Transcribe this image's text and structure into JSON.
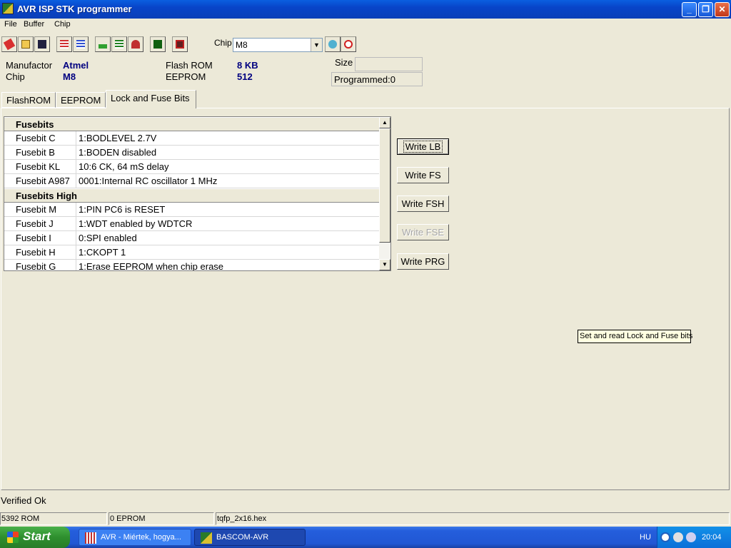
{
  "window": {
    "title": "AVR ISP STK programmer"
  },
  "menu": [
    "File",
    "Buffer",
    "Chip"
  ],
  "toolbar": {
    "chip_label": "Chip",
    "chip_value": "M8",
    "icons": [
      "eraser-icon",
      "open-folder-icon",
      "save-icon",
      "chip-read-icon",
      "chip-write-icon",
      "program-icon",
      "verify-icon",
      "erase-chip-icon",
      "blank-check-icon",
      "lock-icon",
      "refresh-icon",
      "stop-icon"
    ]
  },
  "info": {
    "manufactor_label": "Manufactor",
    "manufactor_value": "Atmel",
    "chip_label": "Chip",
    "chip_value": "M8",
    "flash_label": "Flash ROM",
    "flash_value": "8 KB",
    "eeprom_label": "EEPROM",
    "eeprom_value": "512",
    "size_label": "Size",
    "size_value": "",
    "programmed": "Programmed:0"
  },
  "tabs": [
    "FlashROM",
    "EEPROM",
    "Lock and Fuse Bits"
  ],
  "fuse_list": {
    "group1": "Fusebits",
    "rows1": [
      {
        "name": "Fusebit C",
        "value": "1:BODLEVEL 2.7V"
      },
      {
        "name": "Fusebit B",
        "value": "1:BODEN disabled"
      },
      {
        "name": "Fusebit KL",
        "value": "10:6 CK, 64 mS delay"
      },
      {
        "name": "Fusebit A987",
        "value": "0001:Internal RC oscillator 1 MHz"
      }
    ],
    "group2": "Fusebits High",
    "rows2": [
      {
        "name": "Fusebit M",
        "value": "1:PIN PC6 is RESET"
      },
      {
        "name": "Fusebit J",
        "value": "1:WDT enabled by WDTCR"
      },
      {
        "name": "Fusebit I",
        "value": "0:SPI enabled"
      },
      {
        "name": "Fusebit H",
        "value": "1:CKOPT 1"
      },
      {
        "name": "Fusebit G",
        "value": "1:Erase EEPROM when chip erase"
      }
    ]
  },
  "buttons": {
    "write_lb": "Write LB",
    "write_fs": "Write FS",
    "write_fsh": "Write FSH",
    "write_fse": "Write FSE",
    "write_prg": "Write PRG"
  },
  "tooltip": "Set and read Lock and Fuse bits",
  "status": {
    "message": "Verified Ok",
    "rom": "5392 ROM",
    "eprom": "0 EPROM",
    "file": "tqfp_2x16.hex"
  },
  "taskbar": {
    "start": "Start",
    "tasks": [
      "AVR - Miértek, hogya...",
      "BASCOM-AVR"
    ],
    "lang": "HU",
    "clock": "20:04"
  }
}
